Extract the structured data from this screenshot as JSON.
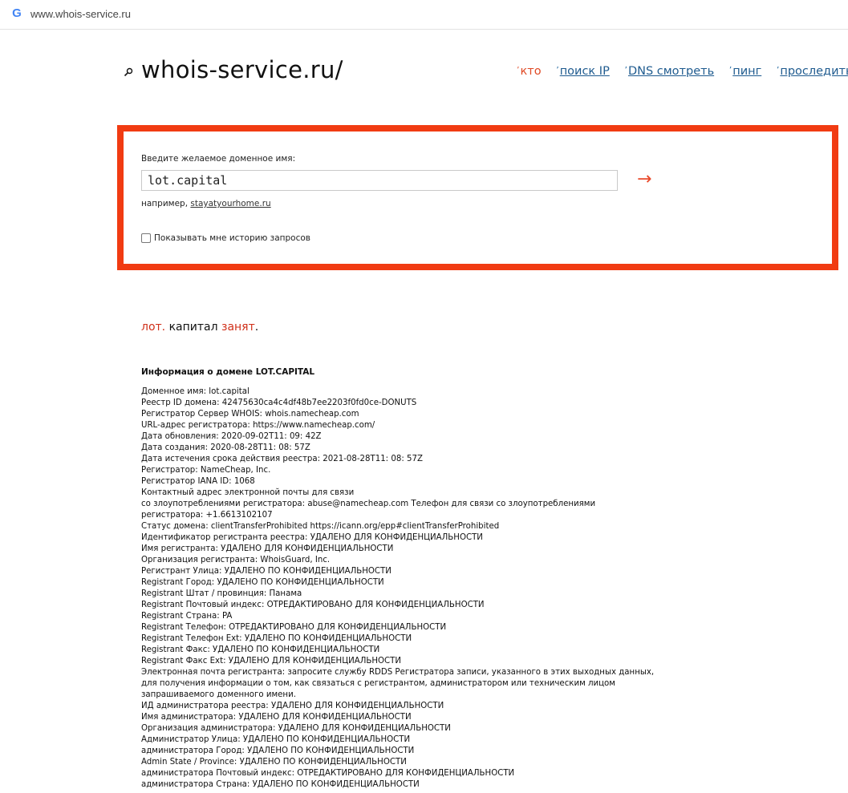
{
  "browser": {
    "url": "www.whois-service.ru",
    "favicon_letter": "G"
  },
  "header": {
    "logo": "whois-service.ru/",
    "nav": [
      {
        "label": "кто",
        "active": true
      },
      {
        "label": "поиск IP",
        "active": false
      },
      {
        "label": "DNS смотреть",
        "active": false
      },
      {
        "label": "пинг",
        "active": false
      },
      {
        "label": "проследить ма",
        "active": false
      }
    ]
  },
  "search": {
    "prompt": "Введите желаемое доменное имя:",
    "value": "lot.capital",
    "submit_arrow": "→",
    "example_prefix": "например,",
    "example_link": "stayatyourhome.ru",
    "history_label": "Показывать мне историю запросов"
  },
  "result": {
    "part1": "лот.",
    "part2": " капитал ",
    "part3": "занят",
    "part4": "."
  },
  "info": {
    "title": "Информация о домене LOT.CAPITAL",
    "lines": [
      "Доменное имя: lot.capital",
      "Реестр ID домена: 42475630ca4c4df48b7ee2203f0fd0ce-DONUTS",
      "Регистратор Сервер WHOIS: whois.namecheap.com",
      "URL-адрес регистратора: https://www.namecheap.com/",
      "Дата обновления: 2020-09-02T11: 09: 42Z",
      "Дата создания: 2020-08-28T11: 08: 57Z",
      "Дата истечения срока действия реестра: 2021-08-28T11: 08: 57Z",
      "Регистратор: NameCheap, Inc.",
      "Регистратор IANA ID: 1068",
      "Контактный адрес электронной почты для связи",
      "со злоупотреблениями регистратора: abuse@namecheap.com Телефон для связи со злоупотреблениями",
      "регистратора: +1.6613102107",
      "Статус домена: clientTransferProhibited https://icann.org/epp#clientTransferProhibited",
      "Идентификатор регистранта реестра: УДАЛЕНО ДЛЯ КОНФИДЕНЦИАЛЬНОСТИ",
      "Имя регистранта: УДАЛЕНО ДЛЯ КОНФИДЕНЦИАЛЬНОСТИ",
      "Организация регистранта: WhoisGuard, Inc.",
      "Регистрант Улица: УДАЛЕНО ПО КОНФИДЕНЦИАЛЬНОСТИ",
      "Registrant Город: УДАЛЕНО ПО КОНФИДЕНЦИАЛЬНОСТИ",
      "Registrant Штат / провинция: Панама",
      "Registrant Почтовый индекс: ОТРЕДАКТИРОВАНО ДЛЯ КОНФИДЕНЦИАЛЬНОСТИ",
      "Registrant Страна: PA",
      "Registrant Телефон: ОТРЕДАКТИРОВАНО ДЛЯ КОНФИДЕНЦИАЛЬНОСТИ",
      "Registrant Телефон Ext: УДАЛЕНО ПО КОНФИДЕНЦИАЛЬНОСТИ",
      "Registrant Факс: УДАЛЕНО ПО КОНФИДЕНЦИАЛЬНОСТИ",
      "Registrant Факс Ext: УДАЛЕНО ДЛЯ КОНФИДЕНЦИАЛЬНОСТИ",
      "Электронная почта регистранта: запросите службу RDDS Регистратора записи, указанного в этих выходных данных,",
      "для получения информации о том, как связаться с регистрантом, администратором или техническим лицом",
      "запрашиваемого доменного имени.",
      "ИД администратора реестра: УДАЛЕНО ДЛЯ КОНФИДЕНЦИАЛЬНОСТИ",
      "Имя администратора: УДАЛЕНО ДЛЯ КОНФИДЕНЦИАЛЬНОСТИ",
      "Организация администратора: УДАЛЕНО ДЛЯ КОНФИДЕНЦИАЛЬНОСТИ",
      "Администратор Улица: УДАЛЕНО ПО КОНФИДЕНЦИАЛЬНОСТИ",
      "администратора Город: УДАЛЕНО ПО КОНФИДЕНЦИАЛЬНОСТИ",
      "Admin State / Province: УДАЛЕНО ПО КОНФИДЕНЦИАЛЬНОСТИ",
      "администратора Почтовый индекс: ОТРЕДАКТИРОВАНО ДЛЯ КОНФИДЕНЦИАЛЬНОСТИ",
      "администратора Страна: УДАЛЕНО ПО КОНФИДЕНЦИАЛЬНОСТИ"
    ]
  },
  "colors": {
    "accent": "#f13b12",
    "link": "#1f5b8f",
    "status_red": "#d0301a"
  }
}
